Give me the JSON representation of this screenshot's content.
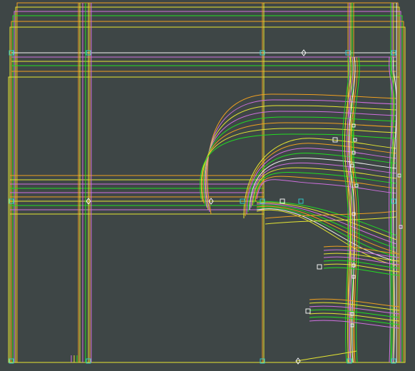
{
  "canvas": {
    "background": "#3e4646"
  },
  "palette": {
    "orange": "#f0a020",
    "yellow": "#e6e632",
    "magenta": "#d070e0",
    "green": "#22dd22",
    "white": "#f4f4f4",
    "cyan": "#30c8c8"
  },
  "element_types": [
    "bezier-curve",
    "guide-line",
    "control-point-handle"
  ]
}
